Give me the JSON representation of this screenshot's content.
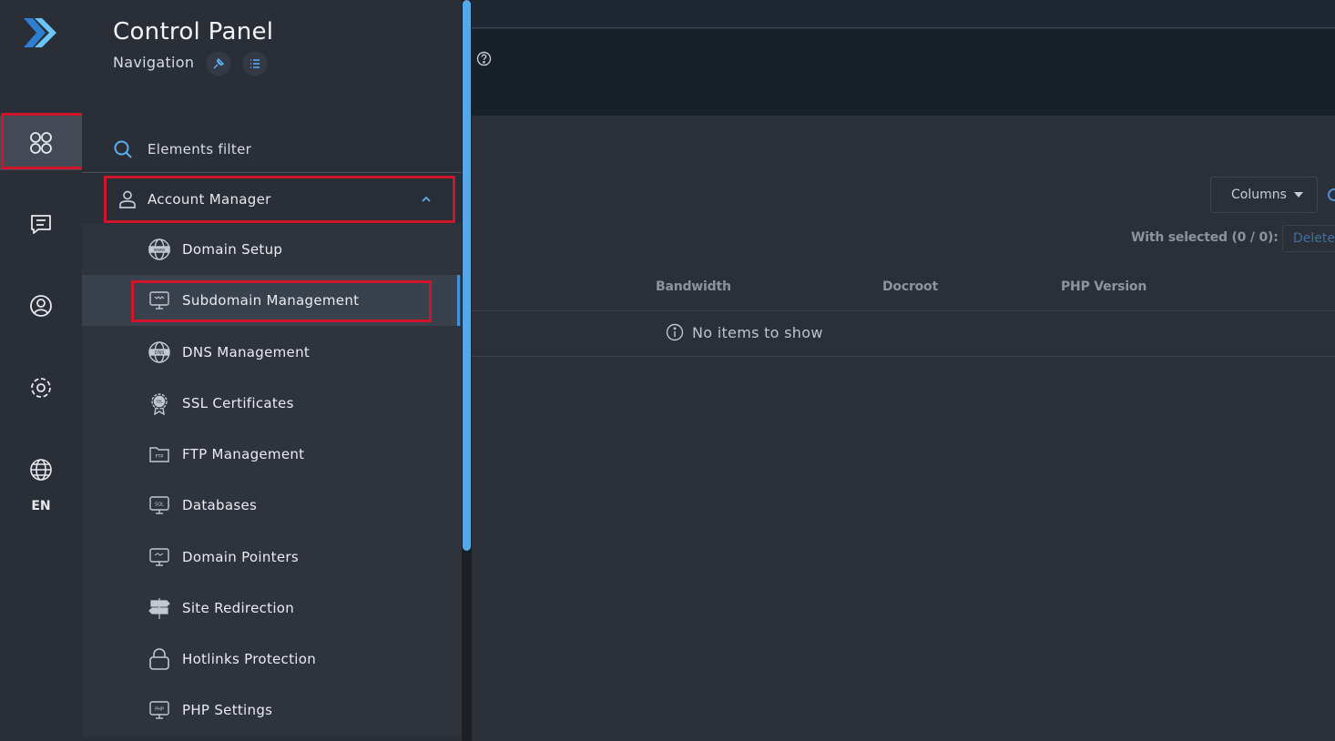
{
  "rail": {
    "language": "EN",
    "icons": [
      "apps-grid-icon",
      "chat-icon",
      "user-circle-icon",
      "settings-icon",
      "globe-icon"
    ]
  },
  "nav": {
    "title": "Control Panel",
    "subtitle": "Navigation",
    "filter_placeholder": "Elements filter",
    "group": {
      "label": "Account Manager",
      "expanded": true
    },
    "items": [
      {
        "label": "Domain Setup",
        "icon": "www-globe-icon"
      },
      {
        "label": "Subdomain Management",
        "icon": "subdomain-monitor-icon",
        "active": true
      },
      {
        "label": "DNS Management",
        "icon": "dns-globe-icon"
      },
      {
        "label": "SSL Certificates",
        "icon": "ssl-badge-icon"
      },
      {
        "label": "FTP Management",
        "icon": "ftp-folder-icon"
      },
      {
        "label": "Databases",
        "icon": "sql-monitor-icon"
      },
      {
        "label": "Domain Pointers",
        "icon": "pointer-monitor-icon"
      },
      {
        "label": "Site Redirection",
        "icon": "signpost-icon"
      },
      {
        "label": "Hotlinks Protection",
        "icon": "lock-icon"
      },
      {
        "label": "PHP Settings",
        "icon": "php-monitor-icon"
      }
    ]
  },
  "main": {
    "columns_button": "Columns",
    "with_selected": "With selected (0 / 0):",
    "delete_button": "Delete",
    "table": {
      "headers": [
        "Bandwidth",
        "Docroot",
        "PHP Version"
      ],
      "empty_message": "No items to show"
    }
  },
  "colors": {
    "accent": "#4a90d9",
    "highlight_border": "#d0152b",
    "panel_bg": "#2a2e36"
  }
}
